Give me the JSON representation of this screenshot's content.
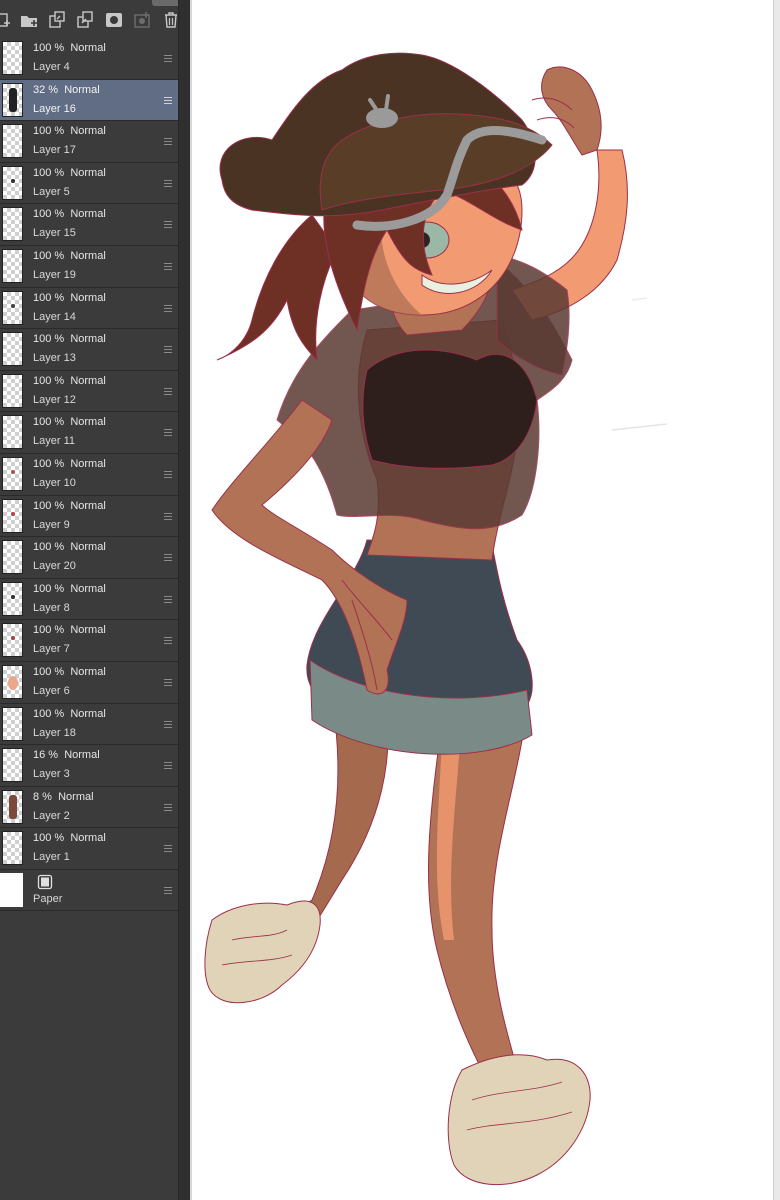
{
  "toolbar": {
    "buttons": [
      {
        "icon": "new-raster-layer-icon"
      },
      {
        "icon": "new-folder-icon"
      },
      {
        "icon": "merge-layer-icon"
      },
      {
        "icon": "copy-layer-icon"
      },
      {
        "icon": "layer-mask-icon"
      },
      {
        "icon": "apply-mask-icon"
      },
      {
        "icon": "delete-layer-icon"
      }
    ]
  },
  "layers": [
    {
      "opacity": "100 %",
      "blend": "Normal",
      "name": "Layer 4",
      "selected": false
    },
    {
      "opacity": "32 %",
      "blend": "Normal",
      "name": "Layer 16",
      "selected": true
    },
    {
      "opacity": "100 %",
      "blend": "Normal",
      "name": "Layer 17",
      "selected": false
    },
    {
      "opacity": "100 %",
      "blend": "Normal",
      "name": "Layer 5",
      "selected": false
    },
    {
      "opacity": "100 %",
      "blend": "Normal",
      "name": "Layer 15",
      "selected": false
    },
    {
      "opacity": "100 %",
      "blend": "Normal",
      "name": "Layer 19",
      "selected": false
    },
    {
      "opacity": "100 %",
      "blend": "Normal",
      "name": "Layer 14",
      "selected": false
    },
    {
      "opacity": "100 %",
      "blend": "Normal",
      "name": "Layer 13",
      "selected": false
    },
    {
      "opacity": "100 %",
      "blend": "Normal",
      "name": "Layer 12",
      "selected": false
    },
    {
      "opacity": "100 %",
      "blend": "Normal",
      "name": "Layer 11",
      "selected": false
    },
    {
      "opacity": "100 %",
      "blend": "Normal",
      "name": "Layer 10",
      "selected": false
    },
    {
      "opacity": "100 %",
      "blend": "Normal",
      "name": "Layer 9",
      "selected": false
    },
    {
      "opacity": "100 %",
      "blend": "Normal",
      "name": "Layer 20",
      "selected": false
    },
    {
      "opacity": "100 %",
      "blend": "Normal",
      "name": "Layer 8",
      "selected": false
    },
    {
      "opacity": "100 %",
      "blend": "Normal",
      "name": "Layer 7",
      "selected": false
    },
    {
      "opacity": "100 %",
      "blend": "Normal",
      "name": "Layer 6",
      "selected": false
    },
    {
      "opacity": "100 %",
      "blend": "Normal",
      "name": "Layer 18",
      "selected": false
    },
    {
      "opacity": "16 %",
      "blend": "Normal",
      "name": "Layer 3",
      "selected": false
    },
    {
      "opacity": "8 %",
      "blend": "Normal",
      "name": "Layer 2",
      "selected": false
    },
    {
      "opacity": "100 %",
      "blend": "Normal",
      "name": "Layer 1",
      "selected": false
    }
  ],
  "paper": {
    "name": "Paper",
    "icon": "paper-layer-icon"
  },
  "colors": {
    "panel_bg": "#3b3b3b",
    "selected_row": "#616c85",
    "canvas_bg": "#ffffff"
  }
}
